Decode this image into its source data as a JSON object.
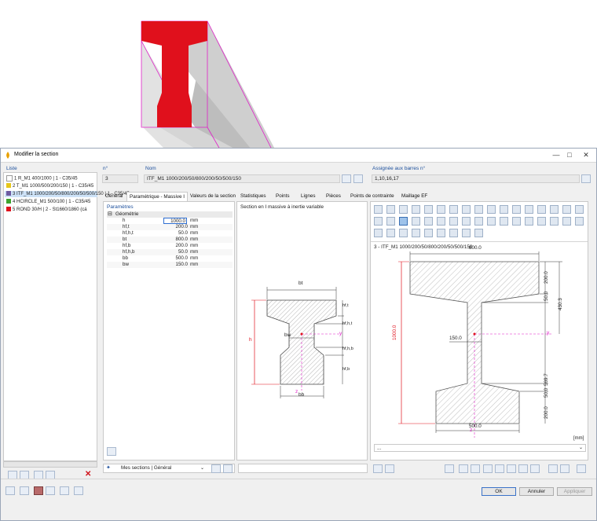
{
  "dialog": {
    "title": "Modifier la section",
    "list_label": "Liste",
    "number_label": "n°",
    "number_value": "3",
    "name_label": "Nom",
    "name_value": "ITF_M1 1000/200/50/800/200/50/500/150",
    "assigned_label": "Assignée aux barres n°",
    "assigned_value": "1,10,16,17",
    "ok": "OK",
    "cancel": "Annuler",
    "apply": "Appliquer"
  },
  "list": {
    "items": [
      {
        "label": "1  R_M1 400/1000 | 1 - C35/45",
        "color": "#ffffff"
      },
      {
        "label": "2  T_M1 1000/500/200/150 | 1 - C35/45",
        "color": "#e6c619"
      },
      {
        "label": "3  ITF_M1 1000/200/50/800/200/50/500/150 | 1 - C35/45",
        "color": "#6d5ba0"
      },
      {
        "label": "4  HCIRCLE_M1 500/100 | 1 - C35/45",
        "color": "#3da32e"
      },
      {
        "label": "5  ROND 30/H | 2 - St1660/1860 (cá",
        "color": "#e0101c"
      }
    ]
  },
  "tabs": [
    "Général",
    "Paramétrique - Massive I",
    "Valeurs de la section",
    "Statistiques",
    "Points",
    "Lignes",
    "Pièces",
    "Points de contrainte",
    "Maillage EF"
  ],
  "params": {
    "header": "Paramètres",
    "group": "Géométrie",
    "rows": [
      {
        "name": "h",
        "value": "1000.0",
        "unit": "mm"
      },
      {
        "name": "hf,t",
        "value": "200.0",
        "unit": "mm"
      },
      {
        "name": "hf,h,t",
        "value": "50.0",
        "unit": "mm"
      },
      {
        "name": "bt",
        "value": "800.0",
        "unit": "mm"
      },
      {
        "name": "hf,b",
        "value": "200.0",
        "unit": "mm"
      },
      {
        "name": "hf,h,b",
        "value": "50.0",
        "unit": "mm"
      },
      {
        "name": "bb",
        "value": "500.0",
        "unit": "mm"
      },
      {
        "name": "bw",
        "value": "150.0",
        "unit": "mm"
      }
    ]
  },
  "diagram": {
    "title": "Section en I massive à inertie variable",
    "bt": "bt",
    "bb": "bb",
    "bw": "bw",
    "h": "h",
    "hft": "hf,t",
    "hfht": "hf,h,t",
    "hfhb": "hf,h,b",
    "hfb": "hf,b",
    "y": "y",
    "z": "z"
  },
  "preview": {
    "title": "3 - ITF_M1 1000/200/50/800/200/50/500/150",
    "dim_top": "800.0",
    "dim_bottom": "500.0",
    "dim_web": "150.0",
    "dim_h": "1000.0",
    "dim_r1": "200.0",
    "dim_r2": "50.0",
    "dim_r3": "430.3",
    "dim_r4": "569.7",
    "dim_r5": "50.0",
    "dim_r6": "200.0",
    "unit": "[mm]",
    "y": "y",
    "z": "z",
    "dropdown": "..."
  },
  "footer": {
    "my_sections": "Mes sections | Général"
  },
  "colors": {
    "accent": "#1c4f9c",
    "red": "#e0101c",
    "magenta": "#e01ec8",
    "hatch": "#d9d9d9"
  }
}
